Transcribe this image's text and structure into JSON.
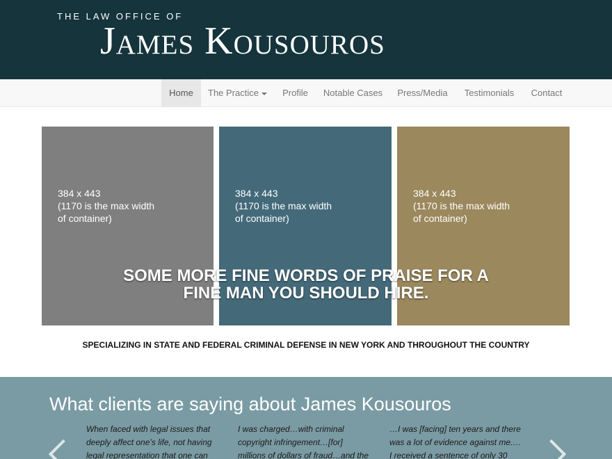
{
  "header": {
    "pretitle": "THE LAW OFFICE OF",
    "name": "James Kousouros",
    "bg_color": "#15343b"
  },
  "nav": {
    "items": [
      {
        "label": "Home",
        "active": true
      },
      {
        "label": "The Practice",
        "dropdown": true
      },
      {
        "label": "Profile"
      },
      {
        "label": "Notable Cases"
      },
      {
        "label": "Press/Media"
      },
      {
        "label": "Testimonials"
      },
      {
        "label": "Contact"
      }
    ]
  },
  "panels": [
    {
      "color": "#7f7f7f",
      "lines": [
        "384 x 443",
        "(1170 is the max width",
        "of container)"
      ]
    },
    {
      "color": "#446a7a",
      "lines": [
        "384 x 443",
        "(1170 is the max width",
        "of container)"
      ]
    },
    {
      "color": "#9b885d",
      "lines": [
        "384 x 443",
        "(1170 is the max width",
        "of container)"
      ]
    }
  ],
  "caption": {
    "line1": "SOME MORE FINE WORDS OF PRAISE FOR A",
    "line2": "FINE MAN YOU SHOULD HIRE."
  },
  "tagline": "SPECIALIZING IN STATE AND FEDERAL CRIMINAL DEFENSE IN NEW YORK AND THROUGHOUT THE COUNTRY",
  "testimonials": {
    "heading": "What clients are saying about James Kousouros",
    "bg_color": "#7a9ba3",
    "quotes": [
      {
        "lines": [
          "When faced with legal issues that",
          "deeply affect one’s life, not having",
          "legal representation that one can"
        ]
      },
      {
        "lines": [
          "I was charged…with criminal",
          "copyright infringement…[for]",
          "millions of dollars of fraud…and the"
        ]
      },
      {
        "lines": [
          "…I was [facing] ten years and there",
          "was a lot of evidence against me.…",
          "I received a sentence of only 30"
        ]
      }
    ]
  }
}
